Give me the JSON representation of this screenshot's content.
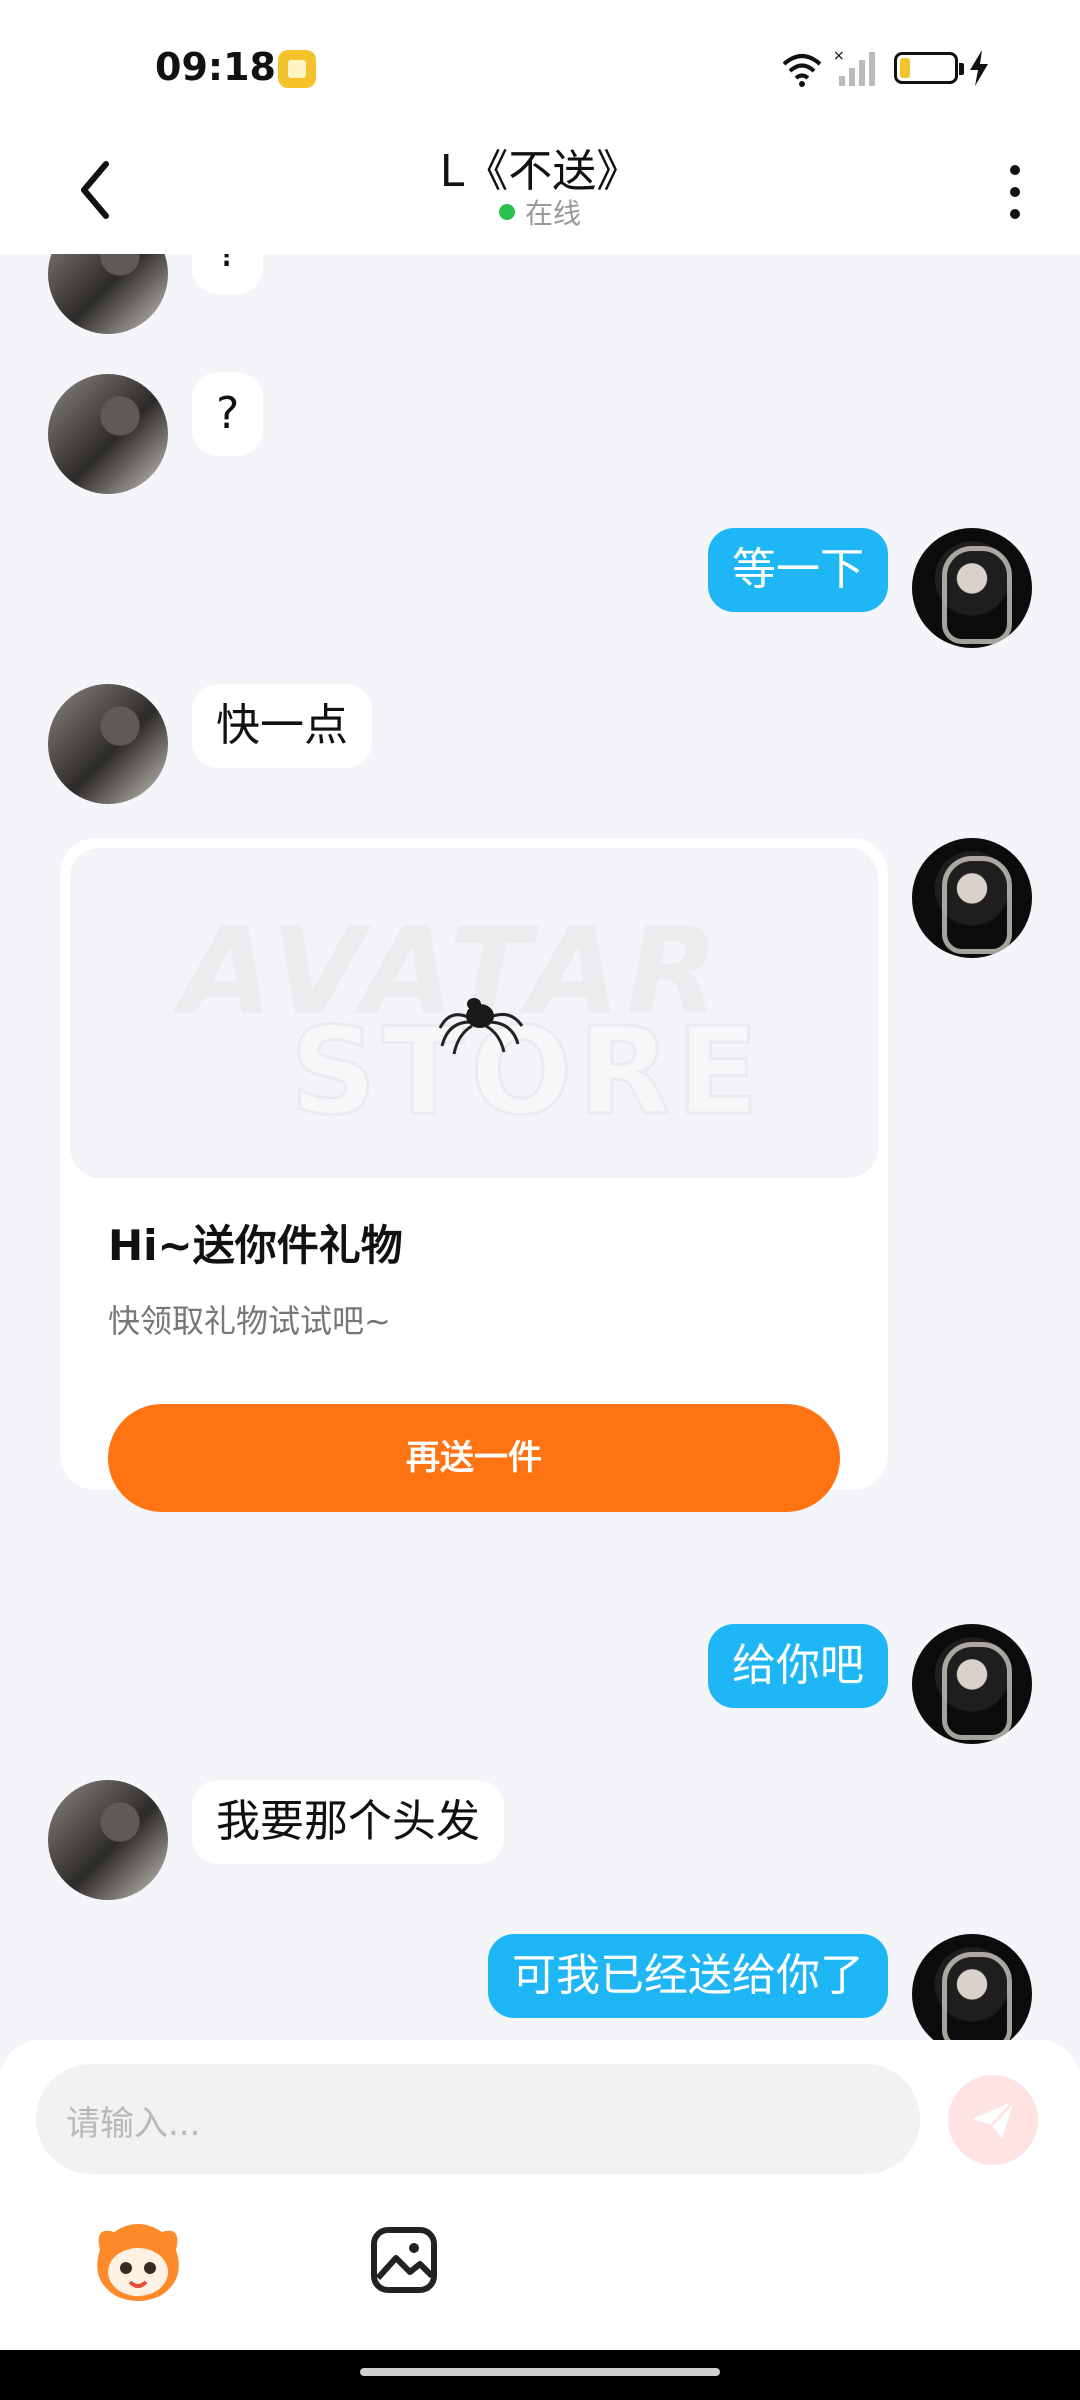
{
  "status": {
    "time": "09:18",
    "battery_level": 0.2
  },
  "header": {
    "title": "L《不送》",
    "status": "在线"
  },
  "messages": [
    {
      "side": "in",
      "text": "?"
    },
    {
      "side": "in",
      "text": "?"
    },
    {
      "side": "out",
      "text": "等一下"
    },
    {
      "side": "in",
      "text": "快一点"
    },
    {
      "side": "out",
      "text": "给你吧"
    },
    {
      "side": "in",
      "text": "我要那个头发"
    },
    {
      "side": "out",
      "text": "可我已经送给你了"
    }
  ],
  "gift_card": {
    "watermark_line1": "AVATAR",
    "watermark_line2": "STORE",
    "title": "Hi~送你件礼物",
    "subtitle": "快领取礼物试试吧~",
    "button_label": "再送一件"
  },
  "composer": {
    "placeholder": "请输入..."
  },
  "icons": {
    "back": "chevron-left-icon",
    "more": "more-vertical-icon",
    "send": "paper-plane-icon",
    "emoji": "mascot-sticker-icon",
    "image": "gallery-icon",
    "gift_item": "spider-icon"
  },
  "colors": {
    "outgoing_bubble": "#1fb6f5",
    "incoming_bubble": "#ffffff",
    "gift_button": "#ff7312",
    "online_dot": "#2bc24d",
    "send_button": "#ffe3e3"
  }
}
